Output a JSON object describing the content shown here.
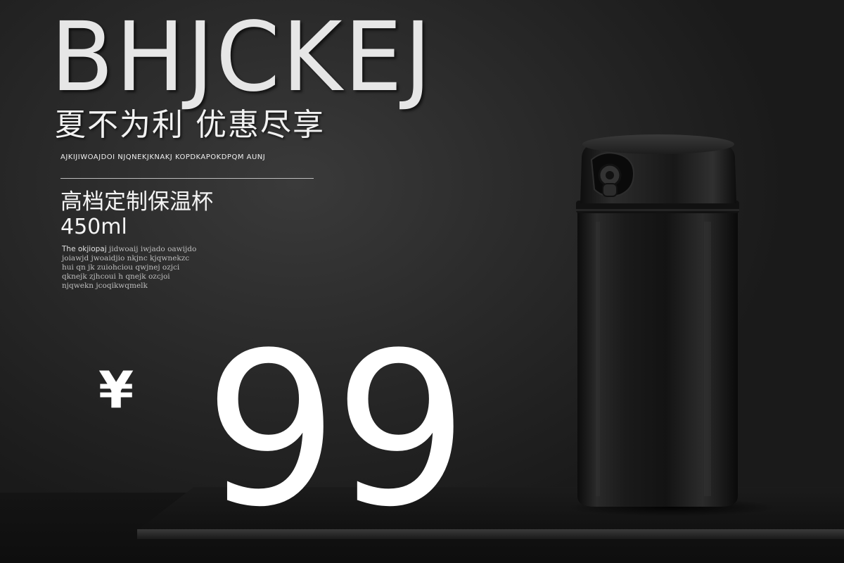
{
  "brand": "BHJCKEJ",
  "slogan": "夏不为利 优惠尽享",
  "subline": "Ajkijiwoajdoi njqnekjknakj kopdkapokdpqm aunj",
  "product": {
    "name": "高档定制保温杯",
    "capacity": "450ml"
  },
  "description": {
    "lead": "The okjiopaj",
    "line1_rest": " jidwoaij iwjado oawijdo",
    "lines": [
      "joiawjd jwoaidjio nkjnc kjqwnekzc",
      "hui qn jk zuiohciou qwjnej ozjci",
      "qknejk zjhcoui h qnejk ozcjoi",
      "njqwekn jcoqikwqmelk"
    ]
  },
  "price": {
    "currency": "¥",
    "amount": "99"
  },
  "image": {
    "subject": "black-vacuum-bottle"
  }
}
